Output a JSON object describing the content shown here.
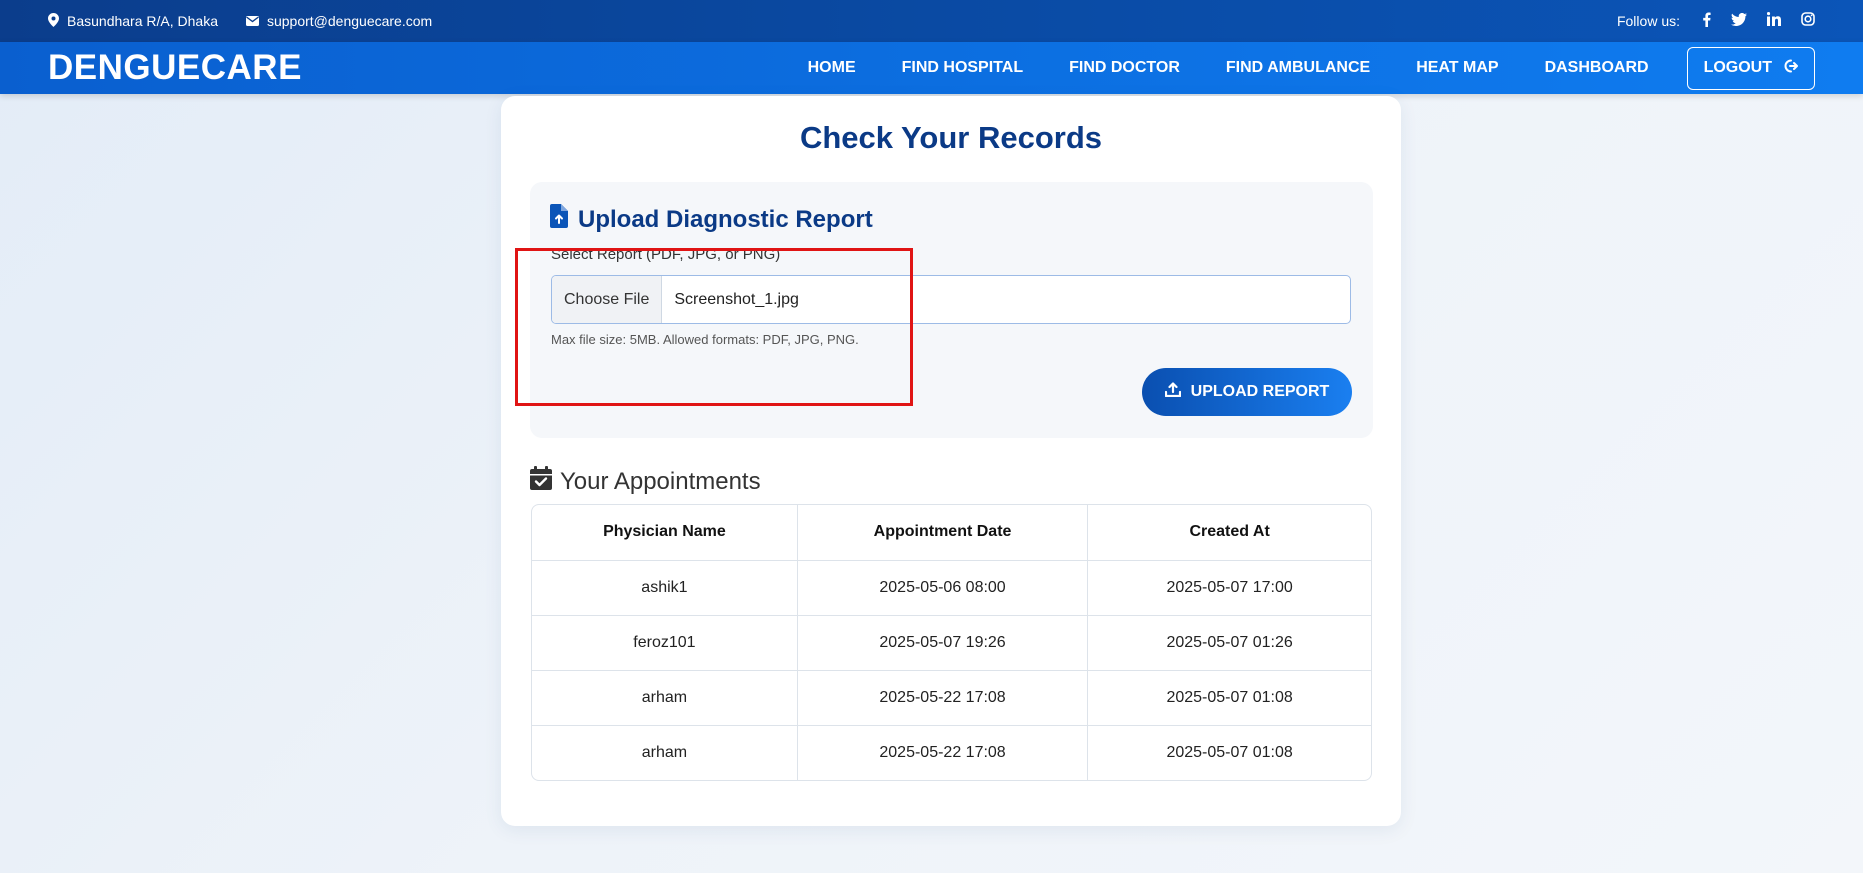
{
  "topbar": {
    "location": "Basundhara R/A, Dhaka",
    "email": "support@denguecare.com",
    "follow_label": "Follow us:",
    "social_icons": [
      "facebook-icon",
      "twitter-icon",
      "linkedin-icon",
      "instagram-icon"
    ]
  },
  "nav": {
    "brand": "DENGUECARE",
    "links": [
      "HOME",
      "FIND HOSPITAL",
      "FIND DOCTOR",
      "FIND AMBULANCE",
      "HEAT MAP",
      "DASHBOARD"
    ],
    "logout": "LOGOUT"
  },
  "page": {
    "title": "Check Your Records"
  },
  "upload": {
    "heading": "Upload Diagnostic Report",
    "label": "Select Report (PDF, JPG, or PNG)",
    "choose_button": "Choose File",
    "file_name": "Screenshot_1.jpg",
    "hint": "Max file size: 5MB. Allowed formats: PDF, JPG, PNG.",
    "button": "UPLOAD REPORT"
  },
  "appointments": {
    "heading": "Your Appointments",
    "columns": [
      "Physician Name",
      "Appointment Date",
      "Created At"
    ],
    "rows": [
      [
        "ashik1",
        "2025-05-06 08:00",
        "2025-05-07 17:00"
      ],
      [
        "feroz101",
        "2025-05-07 19:26",
        "2025-05-07 01:26"
      ],
      [
        "arham",
        "2025-05-22 17:08",
        "2025-05-07 01:08"
      ],
      [
        "arham",
        "2025-05-22 17:08",
        "2025-05-07 01:08"
      ]
    ]
  },
  "colors": {
    "topbar": "#0b3d8c",
    "navbar": "#0c6ee0",
    "title": "#0b3a86",
    "highlight": "#e01414"
  }
}
